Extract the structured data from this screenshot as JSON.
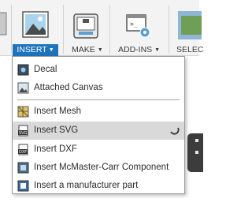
{
  "toolbar": {
    "groups": [
      {
        "label": "INSERT",
        "icon": "image-frame-icon",
        "active": true
      },
      {
        "label": "MAKE",
        "icon": "3d-printer-icon"
      },
      {
        "label": "ADD-INS",
        "icon": "scripts-gear-icon"
      },
      {
        "label": "SELEC",
        "icon": "select-box-icon"
      }
    ],
    "accent": "#1e73be"
  },
  "menu": {
    "items": [
      {
        "label": "Decal",
        "icon": "decal-icon"
      },
      {
        "label": "Attached Canvas",
        "icon": "canvas-icon"
      },
      {
        "label": "Insert Mesh",
        "icon": "mesh-icon"
      },
      {
        "label": "Insert SVG",
        "icon": "svg-file-icon",
        "highlighted": true
      },
      {
        "label": "Insert DXF",
        "icon": "dxf-file-icon"
      },
      {
        "label": "Insert McMaster-Carr Component",
        "icon": "mcmaster-icon"
      },
      {
        "label": "Insert a manufacturer part",
        "icon": "manufacturer-part-icon"
      }
    ],
    "highlight_color": "#d9d9d9"
  }
}
